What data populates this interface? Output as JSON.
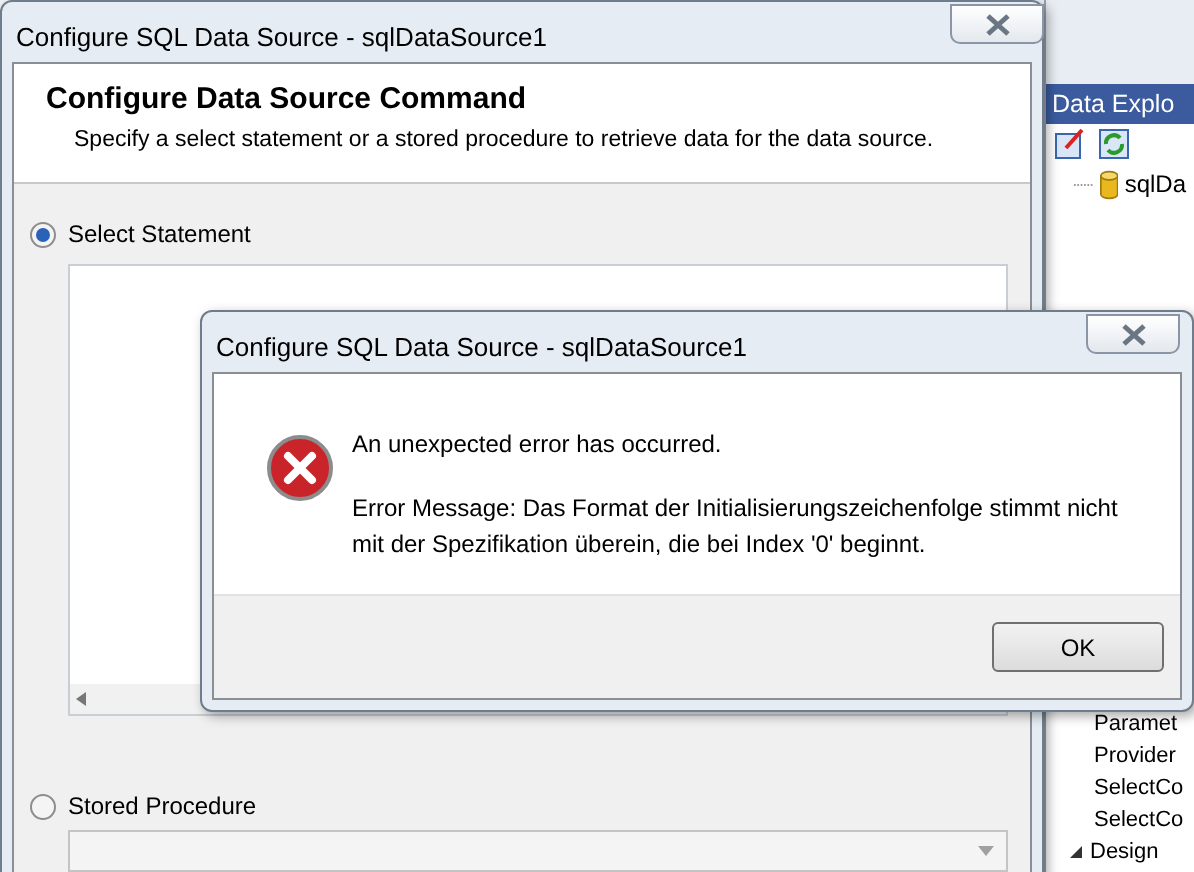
{
  "main_dialog": {
    "title": "Configure SQL Data Source - sqlDataSource1",
    "header": {
      "title": "Configure Data Source Command",
      "subtitle": "Specify a select statement or a stored procedure to retrieve data for the data source."
    },
    "options": [
      {
        "label": "Select Statement",
        "selected": true,
        "kind": "textarea"
      },
      {
        "label": "Stored Procedure",
        "selected": false,
        "kind": "dropdown",
        "disabled": true
      }
    ]
  },
  "data_explorer": {
    "title": "Data Explo",
    "tree_items": [
      "sqlDa"
    ]
  },
  "properties": {
    "items": [
      {
        "label": "Paramet",
        "kind": "property"
      },
      {
        "label": "Provider",
        "kind": "property"
      },
      {
        "label": "SelectCo",
        "kind": "property"
      },
      {
        "label": "SelectCo",
        "kind": "property"
      },
      {
        "label": "Design",
        "kind": "category",
        "expanded": true
      }
    ]
  },
  "error_dialog": {
    "title": "Configure SQL Data Source - sqlDataSource1",
    "message": "An unexpected error has occurred.",
    "detail": "Error Message: Das Format der Initialisierungszeichenfolge stimmt nicht mit der Spezifikation überein, die bei Index '0' beginnt.",
    "buttons": [
      "OK"
    ]
  }
}
